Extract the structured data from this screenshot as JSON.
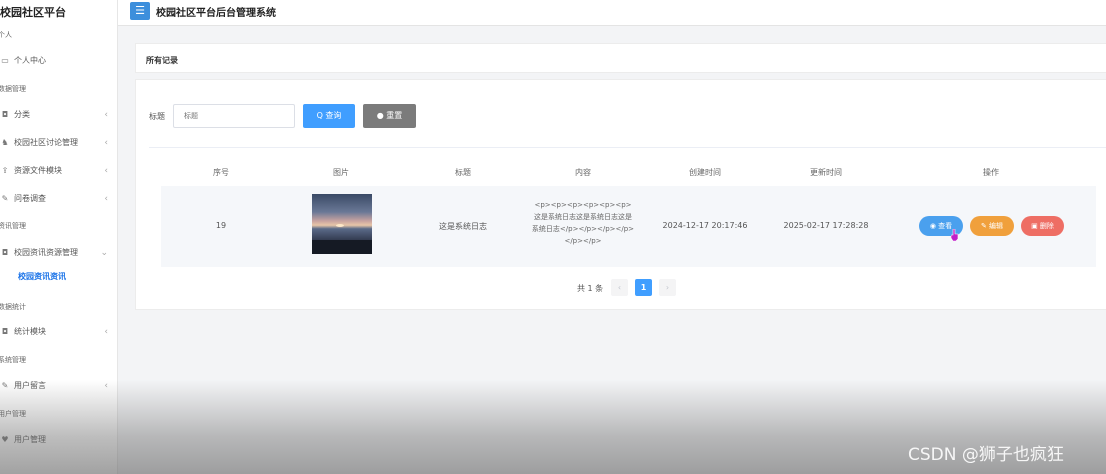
{
  "sidebar": {
    "brand": "校园社区平台",
    "rows": [
      {
        "kind": "group",
        "label": "个人"
      },
      {
        "kind": "item",
        "label": "个人中心",
        "icon": "monitor-icon",
        "glyph": "▭",
        "chev": ""
      },
      {
        "kind": "group",
        "label": "数据管理"
      },
      {
        "kind": "item",
        "label": "分类",
        "icon": "camera-icon",
        "glyph": "◘",
        "chev": "‹"
      },
      {
        "kind": "item",
        "label": "校园社区讨论管理",
        "icon": "people-icon",
        "glyph": "♞",
        "chev": "‹"
      },
      {
        "kind": "item",
        "label": "资源文件模块",
        "icon": "upload-icon",
        "glyph": "⇪",
        "chev": "‹"
      },
      {
        "kind": "item",
        "label": "问卷调查",
        "icon": "edit-icon",
        "glyph": "✎",
        "chev": "‹"
      },
      {
        "kind": "group",
        "label": "资讯管理"
      },
      {
        "kind": "item",
        "label": "校园资讯资源管理",
        "icon": "camera-icon",
        "glyph": "◘",
        "chev": "⌄"
      },
      {
        "kind": "sub",
        "label": "校园资讯资讯"
      },
      {
        "kind": "group",
        "label": "数据统计"
      },
      {
        "kind": "item",
        "label": "统计模块",
        "icon": "camera-icon",
        "glyph": "◘",
        "chev": "‹"
      },
      {
        "kind": "group",
        "label": "系统管理"
      },
      {
        "kind": "item",
        "label": "用户留言",
        "icon": "edit-icon",
        "glyph": "✎",
        "chev": "‹"
      },
      {
        "kind": "group",
        "label": "用户管理"
      },
      {
        "kind": "item",
        "label": "用户管理",
        "icon": "heart-icon",
        "glyph": "♥",
        "chev": ""
      }
    ]
  },
  "topbar": {
    "menu_icon": "☰",
    "title": "校园社区平台后台管理系统"
  },
  "panel": {
    "title": "所有记录"
  },
  "search": {
    "label": "标题",
    "placeholder": "标题",
    "query_label": "Q 查询",
    "reset_label": "● 重置"
  },
  "table": {
    "headers": [
      "序号",
      "图片",
      "标题",
      "内容",
      "创建时间",
      "更新时间",
      "操作"
    ],
    "rows": [
      {
        "index": "19",
        "title": "这是系统日志",
        "content": "<p><p><p><p><p><p>这是系统日志这是系统日志这是系统日志</p></p></p></p></p></p>",
        "created": "2024-12-17 20:17:46",
        "updated": "2025-02-17 17:28:28",
        "actions": {
          "view": "◉ 查看",
          "edit": "✎ 编辑",
          "delete": "▣ 删除"
        }
      }
    ]
  },
  "pagination": {
    "total": "共 1 条",
    "prev": "‹",
    "page": "1",
    "next": "›"
  },
  "watermark": "CSDN @狮子也疯狂",
  "colors": {
    "primary": "#409eff",
    "view": "#4aa0ee",
    "edit": "#f0a03c",
    "delete": "#ee6e64",
    "reset": "#7b7b7b"
  }
}
